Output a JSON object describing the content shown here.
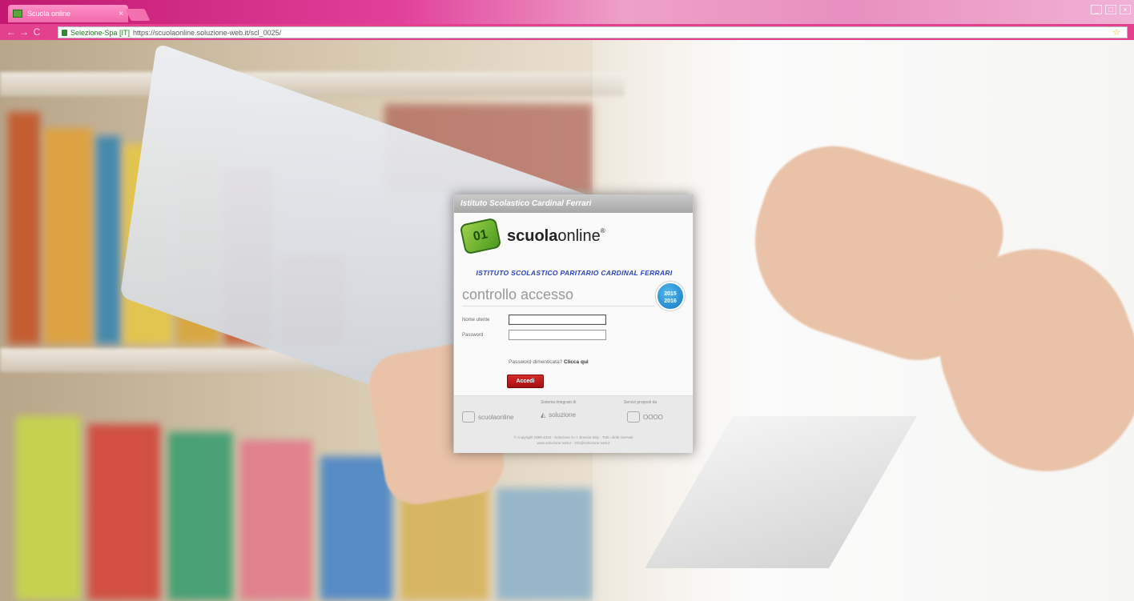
{
  "browser": {
    "tab_title": "Scuola online",
    "tab_close": "×",
    "ssl_label": "Selezione-Spa [IT]",
    "url": "https://scuolaonline.soluzione-web.it/scl_0025/",
    "bookmark_star": "☆",
    "window_controls": [
      "_",
      "□",
      "×"
    ],
    "nav": [
      "←",
      "→",
      "C"
    ]
  },
  "dialog": {
    "header": "Istituto Scolastico Cardinal Ferrari",
    "brand_bold": "scuola",
    "brand_rest": "online",
    "brand_tm": "®",
    "school_name": "ISTITUTO SCOLASTICO PARITARIO CARDINAL FERRARI",
    "title": "controllo accesso",
    "year_line1": "2015",
    "year_line2": "2016",
    "username_label": "Nome utente",
    "username_value": "",
    "password_label": "Password",
    "password_value": "",
    "forgot_text": "Password dimenticata?",
    "forgot_link": "Clicca qui",
    "submit_label": "Accedi",
    "footer": {
      "label_center": "Sistema integrato di",
      "label_right": "Servizi proposti da",
      "logo_left": "scuolaonline",
      "logo_center": "soluzione",
      "logo_right": "OOOO",
      "copyright": "© Copyright 1999-2015 - Soluzione S.r.l. Brescia Italy - Tutti i diritti riservati",
      "copyright2": "www.soluzione-web.it - info@soluzione-web.it"
    }
  },
  "colors": {
    "accent_pink": "#e3418f",
    "brand_blue": "#2b43b8",
    "button_red": "#c21b1b",
    "logo_green": "#6bb42e"
  }
}
